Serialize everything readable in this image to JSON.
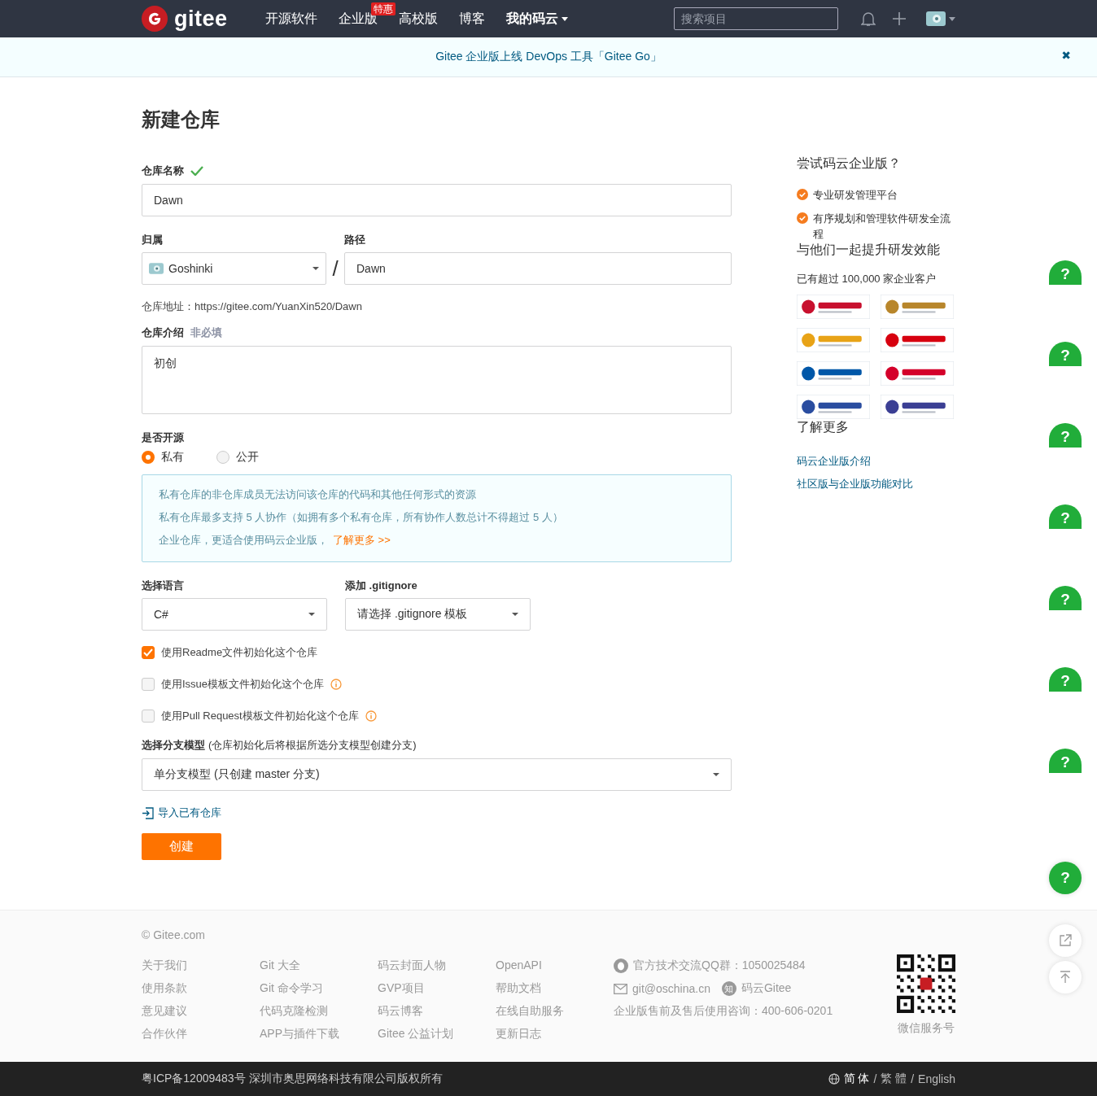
{
  "nav": {
    "logo": "gitee",
    "items": [
      {
        "label": "开源软件",
        "kind": "link"
      },
      {
        "label": "企业版",
        "kind": "link",
        "badge": "特惠"
      },
      {
        "label": "高校版",
        "kind": "link"
      },
      {
        "label": "博客",
        "kind": "link"
      },
      {
        "label": "我的码云",
        "kind": "dropdown"
      }
    ],
    "search": {
      "placeholder": "搜索项目"
    }
  },
  "banner": {
    "text": "Gitee 企业版上线 DevOps 工具「Gitee Go」",
    "close": "✖"
  },
  "page_title": "新建仓库",
  "form": {
    "name": {
      "label": "仓库名称",
      "valid": true,
      "value": "Dawn"
    },
    "owner": {
      "label": "归属",
      "value": "Goshinki"
    },
    "separator": "/",
    "path": {
      "label": "路径",
      "value": "Dawn"
    },
    "address": "仓库地址：https://gitee.com/YuanXin520/Dawn",
    "description": {
      "label": "仓库介绍",
      "hint": "非必填",
      "value": "初创"
    },
    "visibility": {
      "label": "是否开源",
      "options": [
        {
          "label": "私有",
          "selected": true
        },
        {
          "label": "公开",
          "selected": false
        }
      ]
    },
    "notice": {
      "lines": [
        "私有仓库的非仓库成员无法访问该仓库的代码和其他任何形式的资源",
        "私有仓库最多支持 5 人协作（如拥有多个私有仓库，所有协作人数总计不得超过 5 人）",
        "企业仓库，更适合使用码云企业版，"
      ],
      "link": "了解更多 >>"
    },
    "language": {
      "label": "选择语言",
      "value": "C#"
    },
    "gitignore": {
      "label": "添加 .gitignore",
      "value": "请选择 .gitignore 模板"
    },
    "checkboxes": [
      {
        "label": "使用Readme文件初始化这个仓库",
        "checked": true,
        "info": false
      },
      {
        "label": "使用Issue模板文件初始化这个仓库",
        "checked": false,
        "info": true
      },
      {
        "label": "使用Pull Request模板文件初始化这个仓库",
        "checked": false,
        "info": true
      }
    ],
    "branch": {
      "label": "选择分支模型",
      "note": "(仓库初始化后将根据所选分支模型创建分支)",
      "value": "单分支模型 (只创建 master 分支)"
    },
    "import_link": "导入已有仓库",
    "submit": "创建"
  },
  "sidebar": {
    "title": "尝试码云企业版？",
    "features": [
      "专业研发管理平台",
      "有序规划和管理软件研发全流程"
    ],
    "customers_title": "与他们一起提升研发效能",
    "customers_note": "已有超过 100,000 家企业客户",
    "logos": [
      {
        "kind": "picture"
      },
      {
        "kind": "picture"
      },
      {
        "kind": "picture"
      },
      {
        "kind": "picture"
      },
      {
        "kind": "picture"
      },
      {
        "kind": "picture"
      },
      {
        "kind": "picture"
      },
      {
        "kind": "picture"
      }
    ],
    "more_title": "了解更多",
    "links": [
      "码云企业版介绍",
      "社区版与企业版功能对比"
    ]
  },
  "help_buttons": [
    {
      "label": "?",
      "clipped": true
    },
    {
      "label": "?",
      "clipped": true
    },
    {
      "label": "?",
      "clipped": true
    },
    {
      "label": "?",
      "clipped": true
    },
    {
      "label": "?",
      "clipped": true
    },
    {
      "label": "?",
      "clipped": true
    },
    {
      "label": "?",
      "clipped": true
    },
    {
      "label": "?",
      "clipped": false
    }
  ],
  "footer": {
    "copyright": "© Gitee.com",
    "columns": [
      [
        "关于我们",
        "使用条款",
        "意见建议",
        "合作伙伴"
      ],
      [
        "Git 大全",
        "Git 命令学习",
        "代码克隆检测",
        "APP与插件下载"
      ],
      [
        "码云封面人物",
        "GVP项目",
        "码云博客",
        "Gitee 公益计划"
      ],
      [
        "OpenAPI",
        "帮助文档",
        "在线自助服务",
        "更新日志"
      ]
    ],
    "qq": "官方技术交流QQ群：1050025484",
    "email": "git@oschina.cn",
    "zhihu_badge": "知",
    "zhihu": "码云Gitee",
    "phone": "企业版售前及售后使用咨询：400-606-0201",
    "qr_caption": "微信服务号",
    "icp": "粤ICP备12009483号 深圳市奥思网络科技有限公司版权所有",
    "languages": [
      {
        "label": "简 体",
        "selected": true
      },
      {
        "label": "繁 體",
        "selected": false
      },
      {
        "label": "English",
        "selected": false
      }
    ],
    "language_separators": [
      "/",
      "/"
    ]
  }
}
